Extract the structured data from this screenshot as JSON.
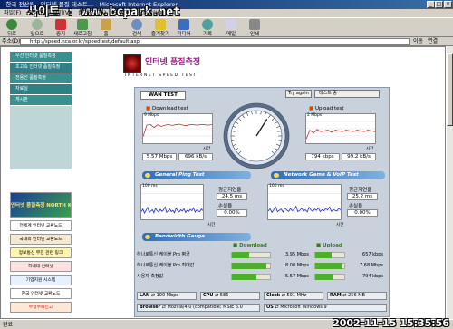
{
  "window": {
    "title": "- 한국 전산원 - 인터넷 품질 테스트... - Microsoft Internet Explorer",
    "watermark": "사이트 : www.bcpark.net",
    "controls": [
      "_",
      "□",
      "×"
    ]
  },
  "menu": [
    "파일(F)",
    "편집(E)",
    "보기(V)",
    "즐겨찾기(A)",
    "도구(T)",
    "도움말(H)"
  ],
  "toolbar": [
    {
      "label": "뒤로",
      "icon": "back-arrow-icon"
    },
    {
      "label": "앞으로",
      "icon": "forward-arrow-icon"
    },
    {
      "label": "중지",
      "icon": "stop-icon"
    },
    {
      "label": "새로고침",
      "icon": "refresh-icon"
    },
    {
      "label": "홈",
      "icon": "home-icon"
    },
    {
      "label": "검색",
      "icon": "search-icon"
    },
    {
      "label": "즐겨찾기",
      "icon": "favorites-icon"
    },
    {
      "label": "미디어",
      "icon": "media-icon"
    },
    {
      "label": "기록",
      "icon": "history-icon"
    },
    {
      "label": "메일",
      "icon": "mail-icon"
    },
    {
      "label": "인쇄",
      "icon": "print-icon"
    }
  ],
  "address": {
    "label": "주소(D)",
    "url": "http://speed.nca.or.kr/speedtest/default.asp",
    "go": "이동",
    "links": "연결"
  },
  "nav": [
    "우선 인터넷 품질측정",
    "초고속 인터넷 품질측정",
    "전용선 품질측정",
    "자료실",
    "게시판"
  ],
  "banners": [
    {
      "label": "인터넷 품질측정 NORTH KOREA",
      "big": true
    },
    {
      "label": "전세계 인터넷 교환노드"
    },
    {
      "label": "국내외 인터넷 교환노드"
    },
    {
      "label": "정보통신 부진 관련 링크"
    },
    {
      "label": "하네대 인터넷"
    },
    {
      "label": "기업지원 시스템"
    },
    {
      "label": "한국 인터넷 교환노드"
    },
    {
      "label": "부정부패신고"
    }
  ],
  "header": {
    "title": "인터넷 품질측정",
    "subtitle": "INTERNET SPEED TEST"
  },
  "panel": {
    "tab": "WAN TEST",
    "try_again": "Try again",
    "test_id": "테스트 중",
    "download": {
      "title": "Download test",
      "ymax": "9 Mbps",
      "xlabel": "시간",
      "mbps": "5.57 Mbps",
      "kbps": "696 kB/s",
      "series": [
        2.1,
        5.6,
        5.8,
        4.9,
        5.7,
        5.2,
        5.6,
        5.8,
        5.5,
        5.7,
        5.9,
        5.6,
        5.4,
        5.8,
        5.7,
        5.6,
        5.8,
        5.7,
        5.6,
        5.8
      ]
    },
    "upload": {
      "title": "Upload test",
      "ymax": "2 Mbps",
      "xlabel": "시간",
      "mbps": "794 kbps",
      "kbps": "99.2 kB/s",
      "series": [
        0.3,
        0.9,
        0.7,
        0.95,
        0.8,
        0.85,
        0.9,
        0.75,
        0.9,
        0.85,
        0.8,
        0.9,
        0.85,
        0.8,
        0.9,
        0.85,
        0.8,
        0.9,
        0.85,
        0.8
      ]
    },
    "sections": {
      "ping": "General Ping Test",
      "game": "Network Game & VoIP Test",
      "gauge": "Bandwidth Gauge"
    },
    "ping": {
      "ymax": "100 ms",
      "xlabel": "시간",
      "avg_label": "평균지연율",
      "avg_value": "24.5 ms",
      "loss_label": "손실율",
      "loss_value": "0.00%",
      "series": [
        22,
        30,
        18,
        26,
        35,
        20,
        24,
        28,
        19,
        32,
        25,
        21,
        29,
        23,
        27,
        36,
        20,
        24,
        30,
        22,
        26,
        19,
        33,
        25,
        21,
        28,
        24,
        31,
        20,
        26,
        23,
        29,
        25,
        34,
        21,
        27,
        24,
        22,
        30,
        25
      ]
    },
    "game": {
      "ymax": "100 ms",
      "xlabel": "시간",
      "avg_label": "평균지연율",
      "avg_value": "25.2 ms",
      "loss_label": "손실율",
      "loss_value": "0.00%",
      "series": [
        24,
        31,
        20,
        28,
        36,
        22,
        26,
        30,
        21,
        33,
        27,
        23,
        31,
        25,
        29,
        38,
        22,
        26,
        32,
        24,
        28,
        21,
        35,
        27,
        23,
        30,
        26,
        33,
        22,
        28,
        25,
        31,
        27,
        36,
        23,
        29,
        26,
        24,
        32,
        27
      ]
    },
    "gauge": {
      "download_header": "Download",
      "upload_header": "Upload",
      "rows": [
        {
          "label": "하나로통신 케이블 Pro 평균",
          "down": "3.95 Mbps",
          "down_frac": 0.45,
          "up": "657 kbps",
          "up_frac": 0.55
        },
        {
          "label": "하나로통신 케이블 Pro 최대값",
          "down": "8.00 Mbps",
          "down_frac": 0.9,
          "up": "7.68 Mbps",
          "up_frac": 0.95
        },
        {
          "label": "사용자 측정값",
          "down": "5.57 Mbps",
          "down_frac": 0.63,
          "up": "794 kbps",
          "up_frac": 0.62
        }
      ]
    },
    "info": [
      {
        "key": "LAN",
        "value": "100 Mbps"
      },
      {
        "key": "CPU",
        "value": "586"
      },
      {
        "key": "Clock",
        "value": "501 MHz"
      },
      {
        "key": "RAM",
        "value": "256 MB"
      },
      {
        "key": "Browser",
        "value": "Mozilla/4.0 (compatible; MSIE 6.0"
      },
      {
        "key": "OS",
        "value": "Microsoft Windows 9"
      }
    ]
  },
  "status": {
    "text": "완료",
    "clock": "2002-11-15 15:35:56"
  }
}
